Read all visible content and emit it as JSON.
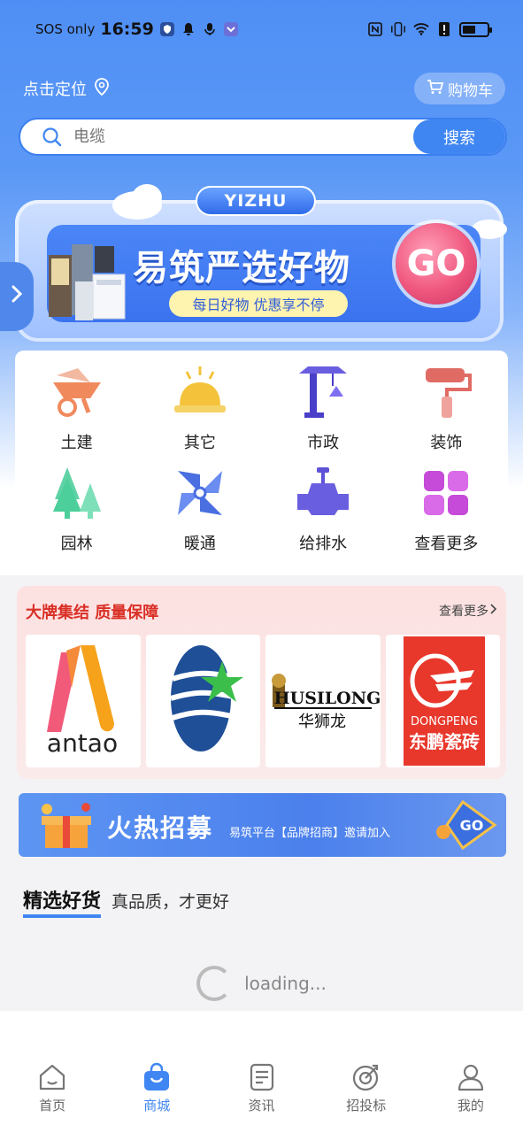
{
  "status_bar": {
    "carrier": "SOS only",
    "time": "16:59",
    "battery_level": 0.55
  },
  "header": {
    "location_label": "点击定位",
    "cart_label": "购物车"
  },
  "search": {
    "placeholder": "电缆",
    "button_label": "搜索"
  },
  "banner": {
    "brand": "YIZHU",
    "title": "易筑严选好物",
    "subtitle": "每日好物 优惠享不停",
    "go_label": "GO"
  },
  "categories": [
    {
      "label": "土建",
      "icon": "wheelbarrow-icon",
      "color": "#f08a5d"
    },
    {
      "label": "其它",
      "icon": "hardhat-icon",
      "color": "#f5c33b"
    },
    {
      "label": "市政",
      "icon": "crane-icon",
      "color": "#5b4fd6"
    },
    {
      "label": "装饰",
      "icon": "paint-roller-icon",
      "color": "#e06b64"
    },
    {
      "label": "园林",
      "icon": "trees-icon",
      "color": "#5fd3a5"
    },
    {
      "label": "暖通",
      "icon": "fan-icon",
      "color": "#4a6fe0"
    },
    {
      "label": "给排水",
      "icon": "valve-icon",
      "color": "#5d52d8"
    },
    {
      "label": "查看更多",
      "icon": "grid-more-icon",
      "color": "#c54bd8"
    }
  ],
  "brands": {
    "title": "大牌集结 质量保障",
    "more_label": "查看更多",
    "items": [
      {
        "name": "antao"
      },
      {
        "name": "star-logo"
      },
      {
        "name": "HUSILONG",
        "cn": "华狮龙"
      },
      {
        "name": "DONGPENG",
        "cn": "东鹏瓷砖"
      }
    ]
  },
  "recruit": {
    "title": "火热招募",
    "subtitle": "易筑平台【品牌招商】邀请加入",
    "go_label": "GO"
  },
  "featured": {
    "title": "精选好货",
    "subtitle": "真品质，才更好"
  },
  "loading": {
    "text": "loading..."
  },
  "tabs": [
    {
      "label": "首页",
      "icon": "home-icon",
      "active": false
    },
    {
      "label": "商城",
      "icon": "shopping-bag-icon",
      "active": true
    },
    {
      "label": "资讯",
      "icon": "news-icon",
      "active": false
    },
    {
      "label": "招投标",
      "icon": "target-icon",
      "active": false
    },
    {
      "label": "我的",
      "icon": "user-icon",
      "active": false
    }
  ],
  "colors": {
    "primary": "#3f86f2",
    "brand_red": "#d93026"
  }
}
